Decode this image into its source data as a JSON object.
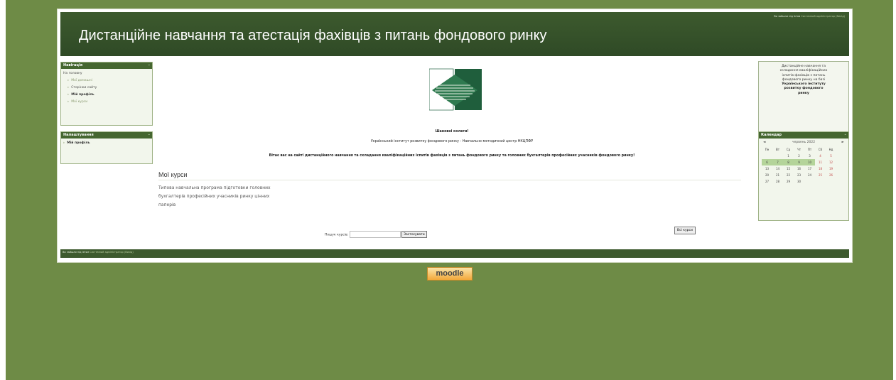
{
  "header": {
    "site_title": "Дистанційне навчання та атестація фахівців з питань фондового ринку",
    "login_prefix": "Ви зайшли під ім'ям",
    "login_user": "Системний адміністратор (Вихід)"
  },
  "navigation": {
    "title": "Навігація",
    "toggle": "–",
    "items": [
      {
        "label": "На головну"
      },
      {
        "label": "Мої домашні"
      },
      {
        "label": "Сторінки сайту"
      },
      {
        "label": "Мій профіль"
      },
      {
        "label": "Мої курси"
      }
    ]
  },
  "settings": {
    "title": "Налаштування",
    "toggle": "–",
    "items": [
      {
        "label": "Мій профіль"
      }
    ]
  },
  "main": {
    "greeting": "Шановні колеги!",
    "institute": "Український інститут розвитку фондового ринку - Навчально-методичний центр НКЦПФР",
    "welcome": "Вітає вас на сайті дистанційного навчання та складання кваліфікаційних іспитів фахівців з питань фондового ринку та головних бухгалтерів професійних учасників фондового ринку!",
    "courses_heading": "Мої курси",
    "courses": [
      {
        "label": "Типова навчальна програма підготовки головних"
      },
      {
        "label": "бухгалтерів професійних учасників ринку цінних"
      },
      {
        "label": "паперів"
      }
    ],
    "search_label": "Пошук курсів:",
    "search_value": "",
    "search_button": "Застосувати",
    "all_courses_button": "Всі курси"
  },
  "info_block": {
    "line1": "Дистанційне навчання та",
    "line2": "складання кваліфікаційних",
    "line3": "іспитів фахівців з питань",
    "line4": "фондового ринку на базі",
    "line5": "Українського інституту",
    "line6": "розвитку фондового",
    "line7": "ринку"
  },
  "calendar": {
    "title": "Календар",
    "toggle": "–",
    "prev": "◄",
    "next": "►",
    "month": "червень 2022",
    "weekdays": [
      "Пн",
      "Вт",
      "Ср",
      "Чт",
      "Пт",
      "Сб",
      "Нд"
    ],
    "weeks": [
      [
        "",
        "",
        "1",
        "2",
        "3",
        "4",
        "5"
      ],
      [
        "6",
        "7",
        "8",
        "9",
        "10",
        "11",
        "12"
      ],
      [
        "13",
        "14",
        "15",
        "16",
        "17",
        "18",
        "19"
      ],
      [
        "20",
        "21",
        "22",
        "23",
        "24",
        "25",
        "26"
      ],
      [
        "27",
        "28",
        "29",
        "30",
        "",
        "",
        ""
      ]
    ]
  },
  "footer": {
    "login_prefix": "Ви зайшли під ім'ям",
    "login_user": "Системний адміністратор (Вихід)",
    "moodle_logo": "moodle"
  },
  "colors": {
    "background": "#6e8b46",
    "header": "#3d5a2e",
    "block_title": "#456630",
    "calendar_highlight": "#b4d49a"
  }
}
